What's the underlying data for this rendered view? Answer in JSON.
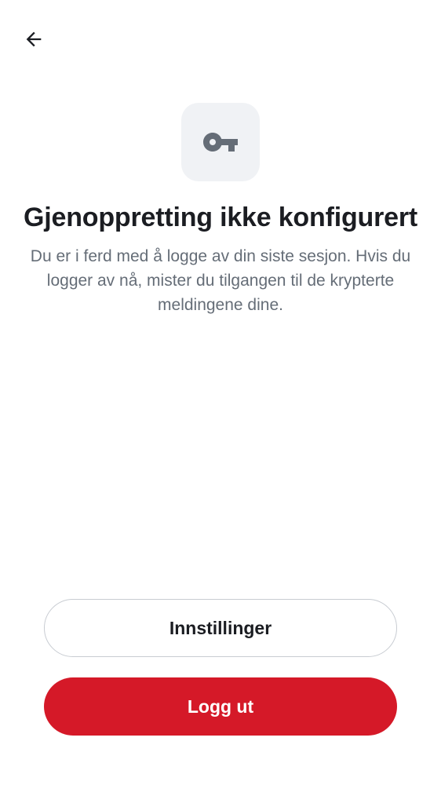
{
  "header": {
    "back_icon": "arrow-left-icon"
  },
  "hero": {
    "icon": "key-icon",
    "title": "Gjenoppretting ikke konfigurert",
    "description": "Du er i ferd med å logge av din siste sesjon. Hvis du logger av nå, mister du tilgangen til de krypterte meldingene dine."
  },
  "actions": {
    "settings_label": "Innstillinger",
    "logout_label": "Logg ut"
  },
  "colors": {
    "primary": "#d51928",
    "icon_tile_bg": "#f0f2f5",
    "icon": "#656d77",
    "text_primary": "#1b1d22",
    "text_secondary": "#656d77",
    "outline": "#c8ccd2"
  }
}
